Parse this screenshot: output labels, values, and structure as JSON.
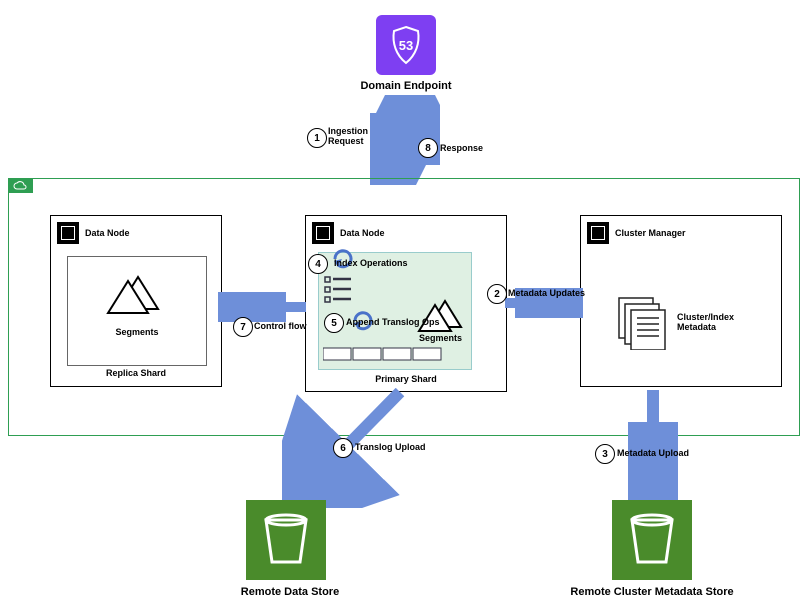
{
  "top": {
    "title": "Domain Endpoint",
    "logo_number": "53"
  },
  "steps": [
    {
      "n": "1",
      "text": "Ingestion\nRequest"
    },
    {
      "n": "2",
      "text": "Metadata Updates"
    },
    {
      "n": "3",
      "text": "Metadata Upload"
    },
    {
      "n": "4",
      "text": "Index Operations"
    },
    {
      "n": "5",
      "text": "Append Translog Ops"
    },
    {
      "n": "6",
      "text": "Translog Upload"
    },
    {
      "n": "7",
      "text": "Control flow"
    },
    {
      "n": "8",
      "text": "Response"
    }
  ],
  "nodes": {
    "left": {
      "title": "Data Node",
      "shard": "Replica Shard",
      "seg": "Segments"
    },
    "mid": {
      "title": "Data Node",
      "shard": "Primary Shard",
      "seg": "Segments"
    },
    "right": {
      "title": "Cluster Manager",
      "doc": "Cluster/Index\nMetadata"
    }
  },
  "bottom": {
    "left": "Remote Data Store",
    "right": "Remote Cluster Metadata Store"
  },
  "colors": {
    "arrow": "#6e8fd9",
    "bucket": "#4a8b2b",
    "logo": "#7e3ff2",
    "cluster": "#2e9e52"
  },
  "chart_data": {
    "type": "flow-diagram",
    "nodes": [
      {
        "id": "endpoint",
        "label": "Domain Endpoint"
      },
      {
        "id": "replica",
        "label": "Data Node / Replica Shard"
      },
      {
        "id": "primary",
        "label": "Data Node / Primary Shard"
      },
      {
        "id": "manager",
        "label": "Cluster Manager"
      },
      {
        "id": "rds",
        "label": "Remote Data Store"
      },
      {
        "id": "rcms",
        "label": "Remote Cluster Metadata Store"
      }
    ],
    "edges": [
      {
        "step": 1,
        "from": "endpoint",
        "to": "primary",
        "label": "Ingestion Request"
      },
      {
        "step": 2,
        "from": "primary",
        "to": "manager",
        "label": "Metadata Updates"
      },
      {
        "step": 3,
        "from": "manager",
        "to": "rcms",
        "label": "Metadata Upload"
      },
      {
        "step": 4,
        "from": "primary",
        "to": "primary",
        "label": "Index Operations",
        "self": true
      },
      {
        "step": 5,
        "from": "primary",
        "to": "primary",
        "label": "Append Translog Ops",
        "self": true
      },
      {
        "step": 6,
        "from": "primary",
        "to": "rds",
        "label": "Translog Upload"
      },
      {
        "step": 7,
        "from": "primary",
        "to": "replica",
        "label": "Control flow"
      },
      {
        "step": 8,
        "from": "primary",
        "to": "endpoint",
        "label": "Response"
      }
    ]
  }
}
